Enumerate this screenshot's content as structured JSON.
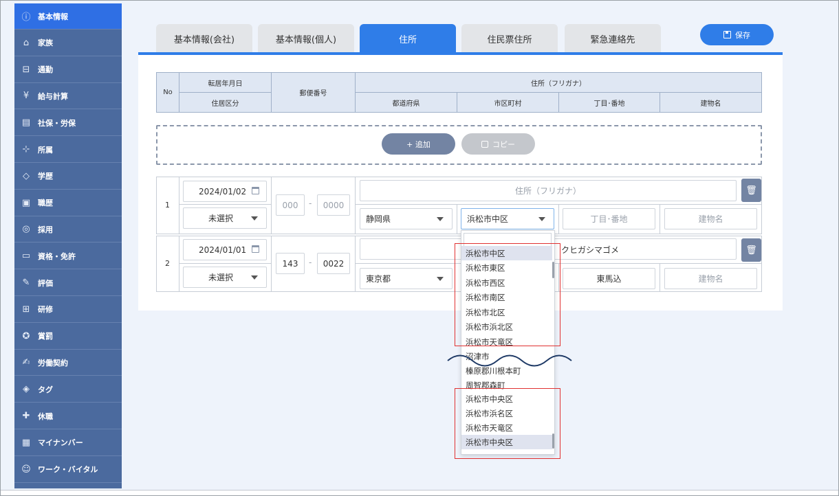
{
  "sidebar": {
    "items": [
      {
        "label": "基本情報",
        "icon": "info-icon",
        "glyph": "ⓘ"
      },
      {
        "label": "家族",
        "icon": "house-icon",
        "glyph": "⌂"
      },
      {
        "label": "通勤",
        "icon": "train-icon",
        "glyph": "⊟"
      },
      {
        "label": "給与計算",
        "icon": "yen-icon",
        "glyph": "¥"
      },
      {
        "label": "社保・労保",
        "icon": "document-icon",
        "glyph": "▤"
      },
      {
        "label": "所属",
        "icon": "org-chart-icon",
        "glyph": "⊹"
      },
      {
        "label": "学歴",
        "icon": "graduation-cap-icon",
        "glyph": "◇"
      },
      {
        "label": "職歴",
        "icon": "briefcase-icon",
        "glyph": "▣"
      },
      {
        "label": "採用",
        "icon": "magnifier-person-icon",
        "glyph": "◎"
      },
      {
        "label": "資格・免許",
        "icon": "certificate-icon",
        "glyph": "▭"
      },
      {
        "label": "評価",
        "icon": "evaluation-icon",
        "glyph": "✎"
      },
      {
        "label": "研修",
        "icon": "presentation-icon",
        "glyph": "⊞"
      },
      {
        "label": "賞罰",
        "icon": "medal-icon",
        "glyph": "✪"
      },
      {
        "label": "労働契約",
        "icon": "contract-icon",
        "glyph": "✍"
      },
      {
        "label": "タグ",
        "icon": "tag-icon",
        "glyph": "◈"
      },
      {
        "label": "休職",
        "icon": "medical-cross-icon",
        "glyph": "✚"
      },
      {
        "label": "マイナンバー",
        "icon": "id-card-icon",
        "glyph": "▦"
      },
      {
        "label": "ワーク・バイタル",
        "icon": "person-heart-icon",
        "glyph": "☺"
      }
    ]
  },
  "tabs": [
    {
      "label": "基本情報(会社)"
    },
    {
      "label": "基本情報(個人)"
    },
    {
      "label": "住所"
    },
    {
      "label": "住民票住所"
    },
    {
      "label": "緊急連絡先"
    }
  ],
  "save_label": "保存",
  "table_header": {
    "no": "No",
    "move_date": "転居年月日",
    "residence_type": "住居区分",
    "postal_code": "郵便番号",
    "address_kana": "住所（フリガナ）",
    "prefecture": "都道府県",
    "city": "市区町村",
    "block": "丁目･番地",
    "building": "建物名"
  },
  "buttons": {
    "add": "+ 追加",
    "copy": "コピー"
  },
  "rows": [
    {
      "no": "1",
      "date": "2024/01/02",
      "residence": "未選択",
      "zip1_placeholder": "000",
      "zip2_placeholder": "0000",
      "kana_placeholder": "住所（フリガナ）",
      "prefecture": "静岡県",
      "city": "浜松市中区",
      "block_placeholder": "丁目･番地",
      "building_placeholder": "建物名"
    },
    {
      "no": "2",
      "date": "2024/01/01",
      "residence": "未選択",
      "zip1": "143",
      "zip2": "0022",
      "kana_visible": "クヒガシマゴメ",
      "prefecture": "東京都",
      "block": "東馬込",
      "building_placeholder": "建物名"
    }
  ],
  "dropdown": {
    "options": [
      "浜松市中区",
      "浜松市東区",
      "浜松市西区",
      "浜松市南区",
      "浜松市北区",
      "浜松市浜北区",
      "浜松市天竜区",
      "沼津市",
      "榛原郡川根本町",
      "周智郡森町",
      "浜松市中央区",
      "浜松市浜名区",
      "浜松市天竜区",
      "浜松市中央区"
    ]
  },
  "colors": {
    "sidebar": "#4b6a9e",
    "accent": "#2f7de8",
    "highlight_box": "#e03030",
    "wave": "#1f3a66"
  }
}
